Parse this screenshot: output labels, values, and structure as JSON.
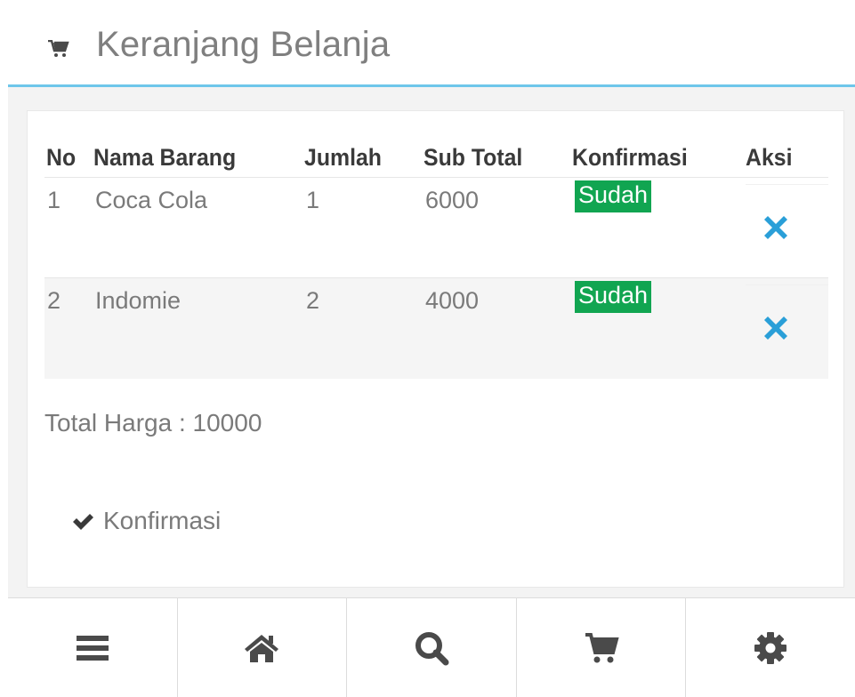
{
  "header": {
    "title": "Keranjang Belanja",
    "icon": "cart-icon"
  },
  "table": {
    "headers": [
      "No",
      "Nama Barang",
      "Jumlah",
      "Sub Total",
      "Konfirmasi",
      "Aksi"
    ],
    "rows": [
      {
        "no": "1",
        "name": "Coca Cola",
        "qty": "1",
        "subtotal": "6000",
        "status": "Sudah",
        "action_icon": "delete-x-icon"
      },
      {
        "no": "2",
        "name": "Indomie",
        "qty": "2",
        "subtotal": "4000",
        "status": "Sudah",
        "action_icon": "delete-x-icon"
      }
    ]
  },
  "total": {
    "text": "Total Harga : 10000"
  },
  "confirm_button": {
    "label": "Konfirmasi",
    "icon": "check-icon"
  },
  "bottom_nav": {
    "items": [
      "menu-icon",
      "home-icon",
      "search-icon",
      "cart-icon",
      "gear-icon"
    ]
  },
  "colors": {
    "accent_line": "#6ec6ea",
    "badge_green": "#11a551",
    "delete_blue": "#2a9fd8",
    "icon_dark": "#4a4a4a"
  }
}
